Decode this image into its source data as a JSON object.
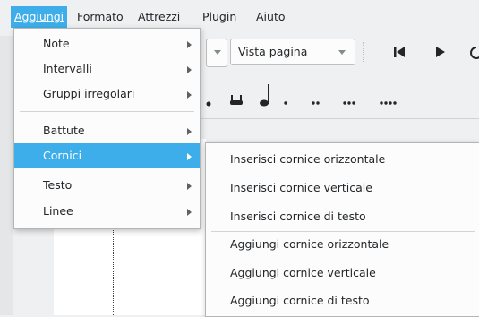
{
  "menubar": {
    "items": [
      {
        "label": "Aggiungi",
        "active": true
      },
      {
        "label": "Formato"
      },
      {
        "label": "Attrezzi"
      },
      {
        "label": "Plugin"
      },
      {
        "label": "Aiuto"
      }
    ]
  },
  "toolbar": {
    "view_combo": "Vista pagina"
  },
  "menu_aggiungi": {
    "items": [
      {
        "label": "Note"
      },
      {
        "label": "Intervalli"
      },
      {
        "label": "Gruppi irregolari"
      },
      {
        "label": "Battute"
      },
      {
        "label": "Cornici",
        "highlighted": true
      },
      {
        "label": "Testo"
      },
      {
        "label": "Linee"
      }
    ]
  },
  "menu_cornici": {
    "items": [
      {
        "label": "Inserisci cornice orizzontale"
      },
      {
        "label": "Inserisci cornice verticale"
      },
      {
        "label": "Inserisci cornice di testo"
      },
      {
        "label": "Aggiungi cornice orizzontale"
      },
      {
        "label": "Aggiungi cornice verticale"
      },
      {
        "label": "Aggiungi cornice di testo"
      }
    ]
  },
  "colors": {
    "accent": "#3daee9",
    "menu_bg": "#fcfcfc",
    "window_bg": "#eff0f1"
  }
}
